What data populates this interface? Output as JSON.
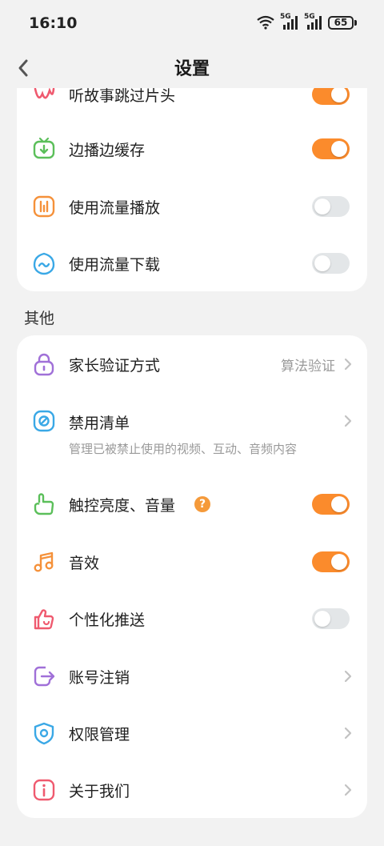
{
  "status": {
    "time": "16:10",
    "battery": "65",
    "net1": "5G",
    "net2": "5G"
  },
  "nav": {
    "title": "设置"
  },
  "section1": {
    "items": [
      {
        "label": "听故事跳过片头",
        "toggle": true
      },
      {
        "label": "边播边缓存",
        "toggle": true
      },
      {
        "label": "使用流量播放",
        "toggle": false
      },
      {
        "label": "使用流量下载",
        "toggle": false
      }
    ]
  },
  "section2": {
    "header": "其他",
    "items": [
      {
        "label": "家长验证方式",
        "value": "算法验证"
      },
      {
        "label": "禁用清单",
        "subtitle": "管理已被禁止使用的视频、互动、音频内容"
      },
      {
        "label": "触控亮度、音量",
        "help": "?",
        "toggle": true
      },
      {
        "label": "音效",
        "toggle": true
      },
      {
        "label": "个性化推送",
        "toggle": false
      },
      {
        "label": "账号注销"
      },
      {
        "label": "权限管理"
      },
      {
        "label": "关于我们"
      }
    ]
  },
  "colors": {
    "accent": "#fb8b2c",
    "toggle_off": "#e3e6e8",
    "background": "#f2f2f2"
  }
}
